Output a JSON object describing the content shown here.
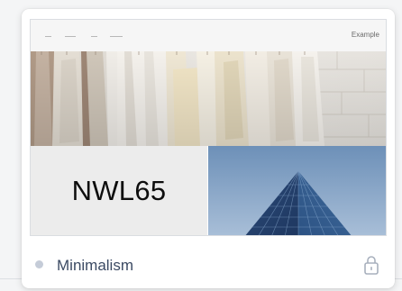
{
  "preview": {
    "nav_example": "Example",
    "brand_text": "NWL65"
  },
  "footer": {
    "theme_name": "Minimalism",
    "lock_icon": "lock-icon"
  },
  "colors": {
    "status_dot": "#c5ccd8",
    "theme_name": "#3b4a63",
    "lock": "#a8b0bd"
  }
}
